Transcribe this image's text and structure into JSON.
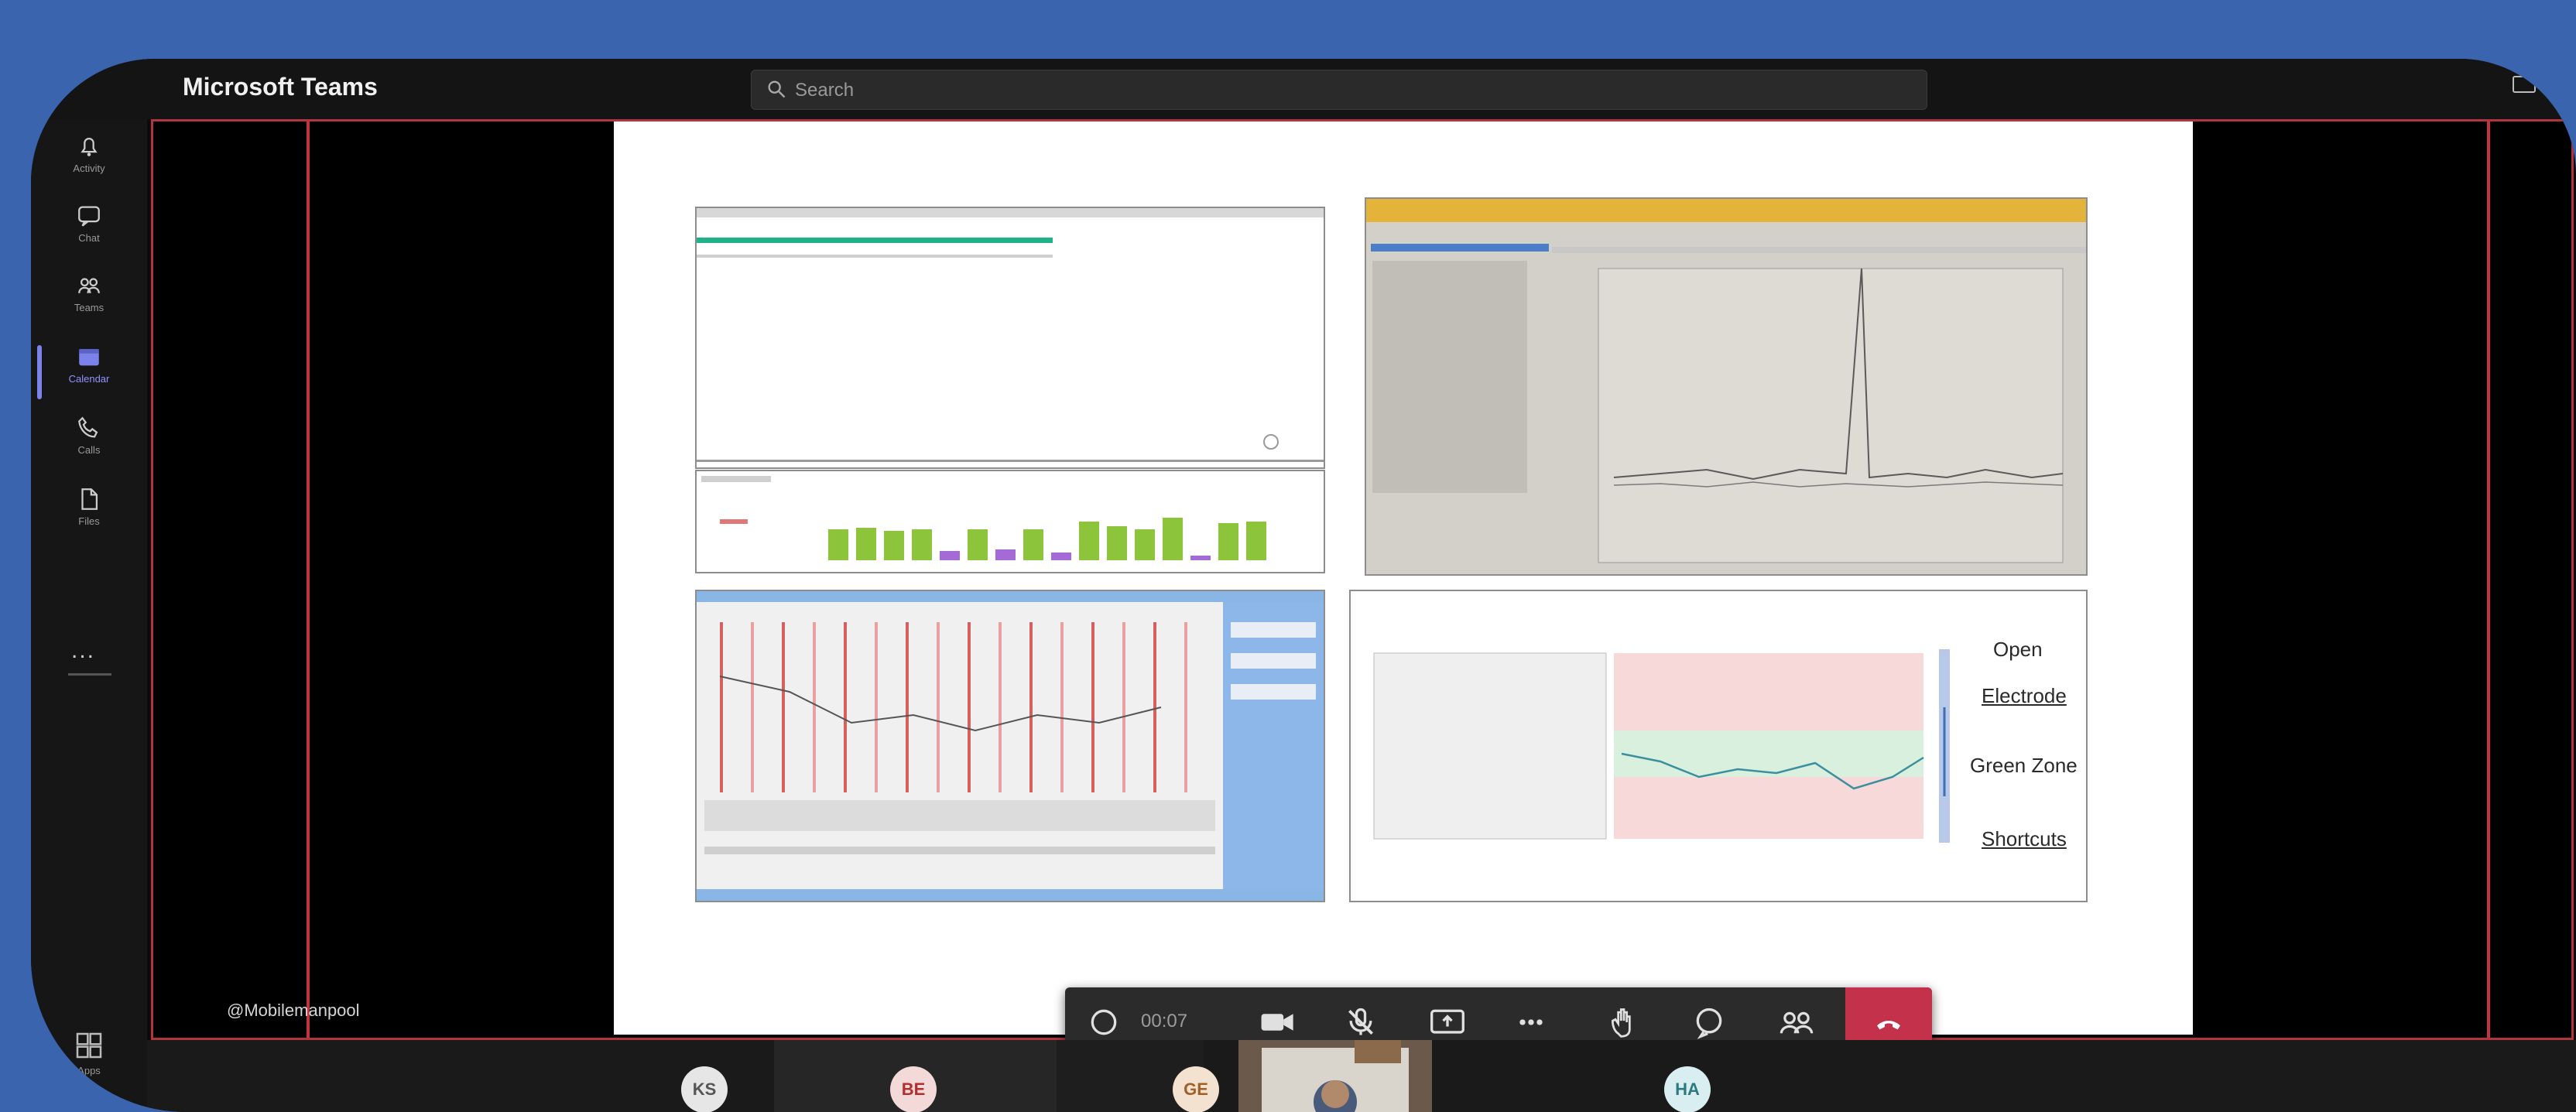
{
  "app": {
    "title": "Microsoft Teams"
  },
  "search": {
    "placeholder": "Search"
  },
  "rail": {
    "items": [
      {
        "label": "Activity",
        "icon": "bell-icon"
      },
      {
        "label": "Chat",
        "icon": "chat-icon"
      },
      {
        "label": "Teams",
        "icon": "teams-icon"
      },
      {
        "label": "Calendar",
        "icon": "calendar-icon"
      },
      {
        "label": "Calls",
        "icon": "phone-icon"
      },
      {
        "label": "Files",
        "icon": "file-icon"
      }
    ],
    "more": "...",
    "apps_label": "Apps"
  },
  "meeting": {
    "presenter": "@Mobilemanpool",
    "timer": "00:07"
  },
  "slide": {
    "labels": [
      "Open",
      "Electrode",
      "Green Zone",
      "Shortcuts"
    ]
  },
  "participants": [
    {
      "initials": "KS",
      "color": "#e6e6e6",
      "text": "#555"
    },
    {
      "initials": "BE",
      "color": "#f4d9d9",
      "text": "#b03030"
    },
    {
      "initials": "GE",
      "color": "#f3e2cf",
      "text": "#a0602a"
    },
    {
      "initials": "HA",
      "color": "#d9eef0",
      "text": "#2b7a82"
    }
  ],
  "colors": {
    "accent": "#7b83eb",
    "hangup": "#c4314b",
    "frame": "#3a64ae"
  }
}
